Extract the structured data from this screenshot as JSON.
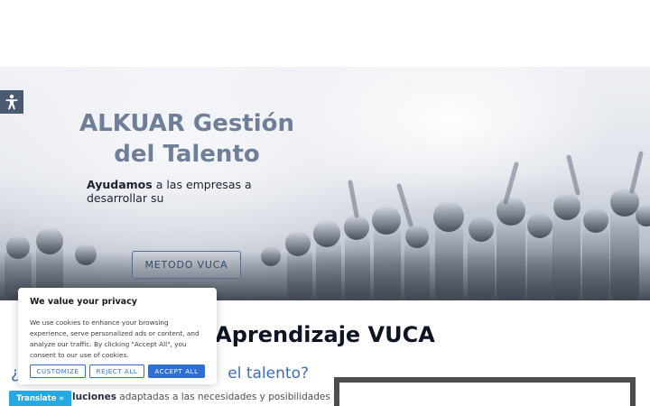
{
  "colors": {
    "hero_title": "#6f7f99",
    "accent_blue": "#3b6fb5",
    "cookie_button": "#2f6fd1",
    "translate_bar": "#26a8e0",
    "accessibility_button": "#4b5a73"
  },
  "accessibility": {
    "icon": "accessibility-person-icon"
  },
  "hero": {
    "title_line1": "ALKUAR Gestión",
    "title_line2": "del Talento",
    "subtitle_bold": "Ayudamos",
    "subtitle_rest": " a las empresas a desarrollar su",
    "cta_label": "METODO VUCA"
  },
  "main": {
    "section_title": "Aprendizaje VUCA",
    "question_start": "¿",
    "question_end": "el talento?",
    "body_bold": "luciones",
    "body_rest": " adaptadas a las necesidades y posibilidades de"
  },
  "cookie_banner": {
    "title": "We value your privacy",
    "text": "We use cookies to enhance your browsing experience, serve personalized ads or content, and analyze our traffic. By clicking \"Accept All\", you consent to our use of cookies.",
    "customize_label": "CUSTOMIZE",
    "reject_label": "REJECT ALL",
    "accept_label": "ACCEPT ALL"
  },
  "translate_bar": {
    "label": "Translate »"
  }
}
